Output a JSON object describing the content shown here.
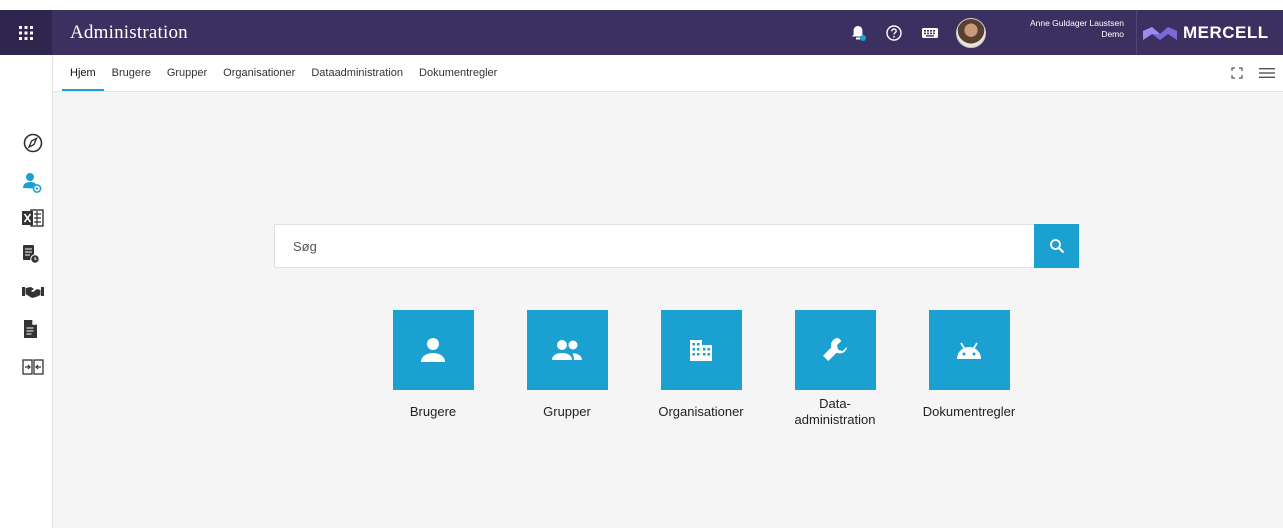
{
  "header": {
    "title": "Administration",
    "user_name": "Anne Guldager Laustsen",
    "user_org": "Demo",
    "brand": "MERCELL",
    "icons": [
      "apps-grid-icon",
      "bell-icon",
      "help-icon",
      "keyboard-icon",
      "avatar"
    ]
  },
  "tabs": [
    {
      "label": "Hjem",
      "active": true
    },
    {
      "label": "Brugere",
      "active": false
    },
    {
      "label": "Grupper",
      "active": false
    },
    {
      "label": "Organisationer",
      "active": false
    },
    {
      "label": "Dataadministration",
      "active": false
    },
    {
      "label": "Dokumentregler",
      "active": false
    }
  ],
  "sidebar": {
    "icons": [
      "compass-icon",
      "user-settings-icon",
      "excel-icon",
      "document-clock-icon",
      "handshake-icon",
      "file-icon",
      "import-export-icon"
    ]
  },
  "search": {
    "placeholder": "Søg",
    "value": ""
  },
  "tiles": [
    {
      "label": "Brugere",
      "icon": "person-icon"
    },
    {
      "label": "Grupper",
      "icon": "people-icon"
    },
    {
      "label": "Organisationer",
      "icon": "building-icon"
    },
    {
      "label": "Data-\nadministration",
      "icon": "wrench-icon"
    },
    {
      "label": "Dokumentregler",
      "icon": "android-icon"
    }
  ],
  "colors": {
    "header_bg": "#3c3060",
    "accent": "#1aa1d2",
    "main_bg": "#f5f5f5"
  }
}
